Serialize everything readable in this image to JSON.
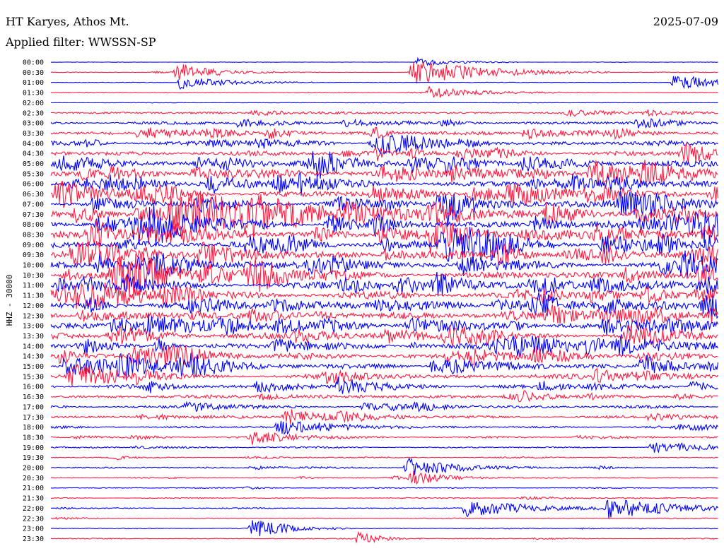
{
  "header": {
    "station": "HT Karyes, Athos Mt.",
    "date": "2025-07-09",
    "filter": "Applied filter: WWSSN-SP"
  },
  "chart_data": {
    "type": "line",
    "subtype": "helicorder",
    "ylabel": "HHZ - 30000",
    "row_labels": [
      "00:00",
      "00:30",
      "01:00",
      "01:30",
      "02:00",
      "02:30",
      "03:00",
      "03:30",
      "04:00",
      "04:30",
      "05:00",
      "05:30",
      "06:00",
      "06:30",
      "07:00",
      "07:30",
      "08:00",
      "08:30",
      "09:00",
      "09:30",
      "10:00",
      "10:30",
      "11:00",
      "11:30",
      "12:00",
      "12:30",
      "13:00",
      "13:30",
      "14:00",
      "14:30",
      "15:00",
      "15:30",
      "16:00",
      "16:30",
      "17:00",
      "17:30",
      "18:00",
      "18:30",
      "19:00",
      "19:30",
      "20:00",
      "20:30",
      "21:00",
      "21:30",
      "22:00",
      "22:30",
      "23:00",
      "23:30"
    ],
    "row_noise_level": [
      0.3,
      0.4,
      0.3,
      0.4,
      0.3,
      1.2,
      1.6,
      2.2,
      2.4,
      2.6,
      3.0,
      3.2,
      3.2,
      3.4,
      3.6,
      3.8,
      3.8,
      3.8,
      3.8,
      3.8,
      3.6,
      3.6,
      3.6,
      3.6,
      3.4,
      3.4,
      3.4,
      3.2,
      3.0,
      3.0,
      2.8,
      2.6,
      2.4,
      1.8,
      1.6,
      1.4,
      1.2,
      1.0,
      0.8,
      0.8,
      0.8,
      0.7,
      0.6,
      0.6,
      0.6,
      0.5,
      0.5,
      0.5
    ],
    "series_colors": [
      "#0000ff",
      "#ff1a40"
    ],
    "events": [
      {
        "row": 0,
        "minute": 16.5,
        "amplitude": 6,
        "duration_min": 1.5
      },
      {
        "row": 1,
        "minute": 16.2,
        "amplitude": 18,
        "duration_min": 3
      },
      {
        "row": 1,
        "minute": 5.6,
        "amplitude": 14,
        "duration_min": 1.5
      },
      {
        "row": 2,
        "minute": 5.8,
        "amplitude": 10,
        "duration_min": 2
      },
      {
        "row": 2,
        "minute": 28.0,
        "amplitude": 12,
        "duration_min": 2
      },
      {
        "row": 3,
        "minute": 17.0,
        "amplitude": 8,
        "duration_min": 2
      },
      {
        "row": 15,
        "minute": 5.4,
        "amplitude": 24,
        "duration_min": 6
      },
      {
        "row": 30,
        "minute": 0.6,
        "amplitude": 12,
        "duration_min": 3
      },
      {
        "row": 35,
        "minute": 10.5,
        "amplitude": 12,
        "duration_min": 2
      },
      {
        "row": 36,
        "minute": 10.2,
        "amplitude": 10,
        "duration_min": 2
      },
      {
        "row": 37,
        "minute": 9.0,
        "amplitude": 10,
        "duration_min": 2
      },
      {
        "row": 38,
        "minute": 27.0,
        "amplitude": 8,
        "duration_min": 2
      },
      {
        "row": 40,
        "minute": 16.0,
        "amplitude": 14,
        "duration_min": 2
      },
      {
        "row": 41,
        "minute": 16.2,
        "amplitude": 10,
        "duration_min": 1.5
      },
      {
        "row": 44,
        "minute": 18.6,
        "amplitude": 12,
        "duration_min": 3
      },
      {
        "row": 44,
        "minute": 25.0,
        "amplitude": 14,
        "duration_min": 3
      },
      {
        "row": 46,
        "minute": 9.0,
        "amplitude": 14,
        "duration_min": 1.5
      },
      {
        "row": 47,
        "minute": 13.8,
        "amplitude": 10,
        "duration_min": 1
      }
    ]
  }
}
